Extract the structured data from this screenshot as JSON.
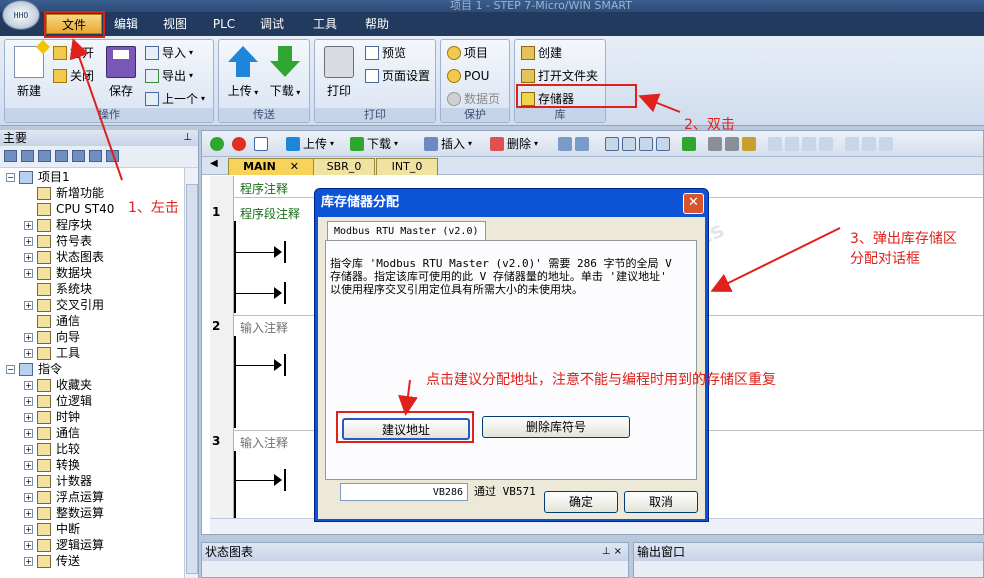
{
  "window": {
    "title": "项目 1 - STEP 7-Micro/WIN SMART"
  },
  "menu": [
    "文件",
    "编辑",
    "视图",
    "PLC",
    "调试",
    "工具",
    "帮助"
  ],
  "ribbon": {
    "groups": {
      "operation": {
        "title": "操作",
        "new": "新建",
        "open": "打开",
        "close": "关闭",
        "save": "保存",
        "import": "导入",
        "export": "导出",
        "prev": "上一个"
      },
      "transfer": {
        "title": "传送",
        "upload": "上传",
        "download": "下载"
      },
      "print": {
        "title": "打印",
        "print": "打印",
        "preview": "预览",
        "page_setup": "页面设置"
      },
      "protect": {
        "title": "保护",
        "project": "项目",
        "pou": "POU",
        "data_page": "数据页"
      },
      "library": {
        "title": "库",
        "create": "创建",
        "open_folder": "打开文件夹",
        "memory": "存储器"
      }
    }
  },
  "left_pane": {
    "title": "主要",
    "tree": [
      {
        "label": "项目1",
        "level": 0,
        "exp": "−"
      },
      {
        "label": "新增功能",
        "level": 1
      },
      {
        "label": "CPU ST40",
        "level": 1
      },
      {
        "label": "程序块",
        "level": 1,
        "exp": "+"
      },
      {
        "label": "符号表",
        "level": 1,
        "exp": "+"
      },
      {
        "label": "状态图表",
        "level": 1,
        "exp": "+"
      },
      {
        "label": "数据块",
        "level": 1,
        "exp": "+"
      },
      {
        "label": "系统块",
        "level": 1
      },
      {
        "label": "交叉引用",
        "level": 1,
        "exp": "+"
      },
      {
        "label": "通信",
        "level": 1
      },
      {
        "label": "向导",
        "level": 1,
        "exp": "+"
      },
      {
        "label": "工具",
        "level": 1,
        "exp": "+"
      },
      {
        "label": "指令",
        "level": 0,
        "exp": "−"
      },
      {
        "label": "收藏夹",
        "level": 1,
        "exp": "+"
      },
      {
        "label": "位逻辑",
        "level": 1,
        "exp": "+"
      },
      {
        "label": "时钟",
        "level": 1,
        "exp": "+"
      },
      {
        "label": "通信",
        "level": 1,
        "exp": "+"
      },
      {
        "label": "比较",
        "level": 1,
        "exp": "+"
      },
      {
        "label": "转换",
        "level": 1,
        "exp": "+"
      },
      {
        "label": "计数器",
        "level": 1,
        "exp": "+"
      },
      {
        "label": "浮点运算",
        "level": 1,
        "exp": "+"
      },
      {
        "label": "整数运算",
        "level": 1,
        "exp": "+"
      },
      {
        "label": "中断",
        "level": 1,
        "exp": "+"
      },
      {
        "label": "逻辑运算",
        "level": 1,
        "exp": "+"
      },
      {
        "label": "传送",
        "level": 1,
        "exp": "+"
      }
    ]
  },
  "editor": {
    "toolbar": {
      "upload": "上传",
      "download": "下载",
      "insert": "插入",
      "delete": "删除"
    },
    "tabs": [
      "MAIN",
      "SBR_0",
      "INT_0"
    ],
    "program_comment": "程序注释",
    "networks": [
      {
        "num": "1",
        "comment": "程序段注释"
      },
      {
        "num": "2",
        "comment": "输入注释"
      },
      {
        "num": "3",
        "comment": "输入注释"
      }
    ]
  },
  "bottom_panes": {
    "status_chart": "状态图表",
    "output_window": "输出窗口"
  },
  "dialog": {
    "title": "库存储器分配",
    "tab": "Modbus RTU Master (v2.0)",
    "description": "指令库 'Modbus RTU Master (v2.0)' 需要 286 字节的全局 V 存储器。指定该库可使用的此 V 存储器量的地址。单击 '建议地址' 以使用程序交叉引用定位具有所需大小的未使用块。",
    "suggest_button": "建议地址",
    "delete_symbols_button": "删除库符号",
    "address_value": "VB286",
    "through_text": "通过  VB571",
    "ok_button": "确定",
    "cancel_button": "取消"
  },
  "annotations": {
    "step1": "1、左击",
    "step2": "2、双击",
    "step3_line1": "3、弹出库存储区",
    "step3_line2": "分配对话框",
    "note": "点击建议分配地址，注意不能与编程时用到的存储区重复"
  },
  "watermark": {
    "line1": "西门子工业技术论坛",
    "line2": "support.industry.siemens.com/cs"
  },
  "colors": {
    "accent_red": "#e0201a",
    "dialog_blue": "#0d53d6",
    "menu_bg": "#213a5e"
  }
}
